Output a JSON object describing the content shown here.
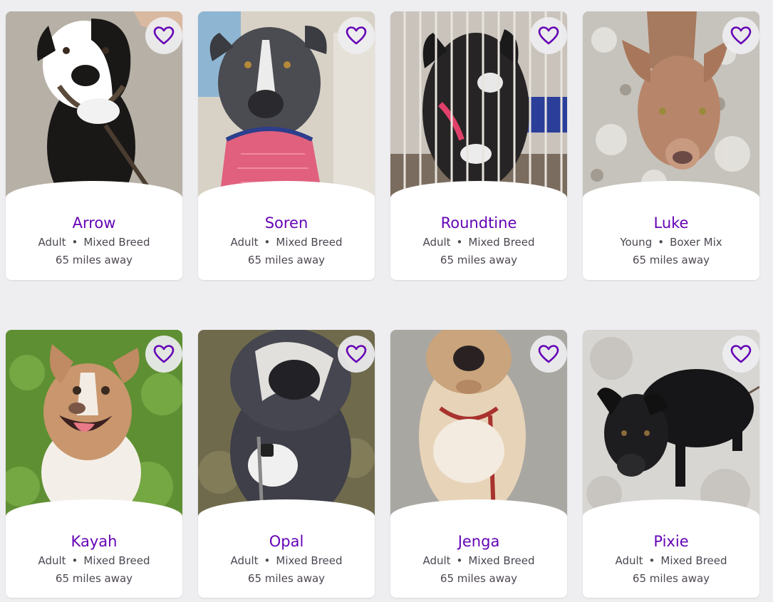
{
  "pets": [
    {
      "name": "Arrow",
      "age": "Adult",
      "breed": "Mixed Breed",
      "distance": "65 miles away"
    },
    {
      "name": "Soren",
      "age": "Adult",
      "breed": "Mixed Breed",
      "distance": "65 miles away"
    },
    {
      "name": "Roundtine",
      "age": "Adult",
      "breed": "Mixed Breed",
      "distance": "65 miles away"
    },
    {
      "name": "Luke",
      "age": "Young",
      "breed": "Boxer Mix",
      "distance": "65 miles away"
    },
    {
      "name": "Kayah",
      "age": "Adult",
      "breed": "Mixed Breed",
      "distance": "65 miles away"
    },
    {
      "name": "Opal",
      "age": "Adult",
      "breed": "Mixed Breed",
      "distance": "65 miles away"
    },
    {
      "name": "Jenga",
      "age": "Adult",
      "breed": "Mixed Breed",
      "distance": "65 miles away"
    },
    {
      "name": "Pixie",
      "age": "Adult",
      "breed": "Mixed Breed",
      "distance": "65 miles away"
    }
  ],
  "separator": "•",
  "colors": {
    "accent": "#6504b5",
    "text": "#4d4751",
    "background": "#eeeef1",
    "card": "#ffffff"
  },
  "icons": {
    "favorite": "heart-outline-icon"
  }
}
